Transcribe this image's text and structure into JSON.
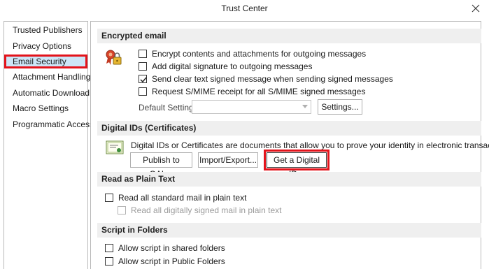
{
  "window": {
    "title": "Trust Center"
  },
  "sidebar": {
    "items": [
      {
        "label": "Trusted Publishers"
      },
      {
        "label": "Privacy Options"
      },
      {
        "label": "Email Security"
      },
      {
        "label": "Attachment Handling"
      },
      {
        "label": "Automatic Download"
      },
      {
        "label": "Macro Settings"
      },
      {
        "label": "Programmatic Access"
      }
    ],
    "selected": "Email Security"
  },
  "encrypted_email": {
    "header": "Encrypted email",
    "icon": "certificate-lock-icon",
    "options": [
      {
        "label": "Encrypt contents and attachments for outgoing messages",
        "checked": false
      },
      {
        "label": "Add digital signature to outgoing messages",
        "checked": false
      },
      {
        "label": "Send clear text signed message when sending signed messages",
        "checked": true
      },
      {
        "label": "Request S/MIME receipt for all S/MIME signed messages",
        "checked": false
      }
    ],
    "default_setting_label": "Default Setting:",
    "default_setting_value": "",
    "settings_button": "Settings..."
  },
  "digital_ids": {
    "header": "Digital IDs (Certificates)",
    "icon": "certificate-icon",
    "description": "Digital IDs or Certificates are documents that allow you to prove your identity in electronic transactions.",
    "buttons": {
      "publish": "Publish to GAL...",
      "import_export": "Import/Export...",
      "get_id": "Get a Digital ID..."
    }
  },
  "plain_text": {
    "header": "Read as Plain Text",
    "options": [
      {
        "label": "Read all standard mail in plain text",
        "checked": false,
        "enabled": true
      },
      {
        "label": "Read all digitally signed mail in plain text",
        "checked": false,
        "enabled": false
      }
    ]
  },
  "script_folders": {
    "header": "Script in Folders",
    "options": [
      {
        "label": "Allow script in shared folders",
        "checked": false
      },
      {
        "label": "Allow script in Public Folders",
        "checked": false
      }
    ]
  },
  "colors": {
    "highlight_red": "#e3131b",
    "selected_bg": "#cde6f7",
    "section_bg": "#efefef"
  }
}
